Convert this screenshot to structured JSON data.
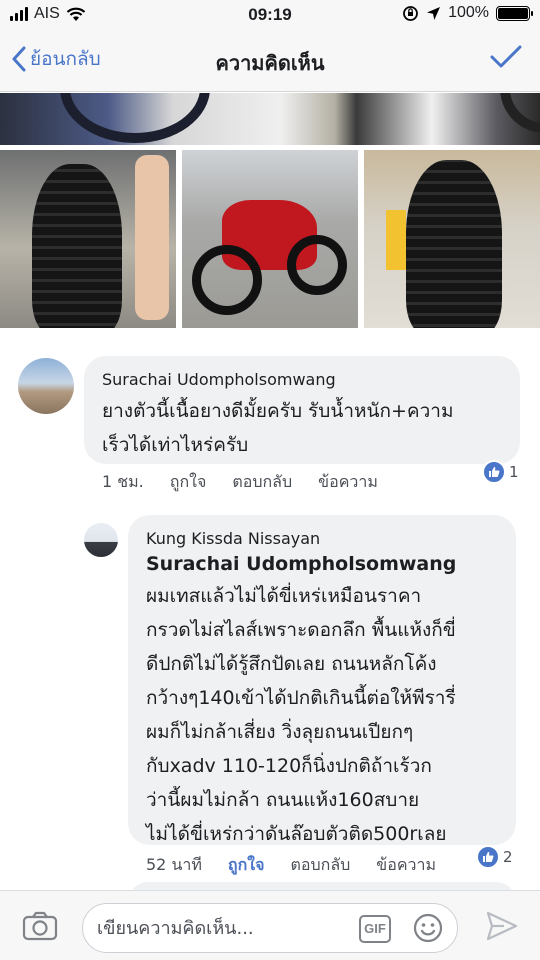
{
  "status_bar": {
    "carrier": "AIS",
    "time": "09:19",
    "battery": "100%"
  },
  "nav": {
    "back_label": "ย้อนกลับ",
    "title": "ความคิดเห็น"
  },
  "comments": [
    {
      "author": "Surachai Udompholsomwang",
      "lines": [
        "ยางตัวนี้เนื้อยางดีมั้ยครับ รับน้ำหนัก+ความ",
        "เร็วได้เท่าไหร่ครับ"
      ],
      "time": "1 ชม.",
      "like": "ถูกใจ",
      "reply": "ตอบกลับ",
      "message": "ข้อความ",
      "like_count": "1"
    },
    {
      "author": "Kung Kissda Nissayan",
      "tag": "Surachai Udompholsomwang",
      "lines": [
        "ผมเทสแล้วไม่ได้ขี่เหร่เหมือนราคา",
        "กรวดไม่สไลส์เพราะดอกลึก พื้นแห้งก็ขี่",
        "ดีปกติไม่ได้รู้สึกปัดเลย  ถนนหลักโค้ง",
        "กว้างๆ140เข้าได้ปกติเกินนี้ต่อให้พีรารี่",
        "ผมก็ไม่กล้าเสี่ยง  วิ่งลุยถนนเปียกๆ",
        "กับxadv   110-120ก็นิ่งปกติถ้าเร้วก",
        "ว่านี้ผมไม่กล้า  ถนนแห้ง160สบาย",
        "ไม่ได้ขี่เหร่กว่าดันล๊อบตัวติด500rเลย"
      ],
      "time": "52 นาที",
      "like": "ถูกใจ",
      "reply": "ตอบกลับ",
      "message": "ข้อความ",
      "like_count": "2"
    }
  ],
  "composer": {
    "placeholder": "เขียนความคิดเห็น...",
    "gif_label": "GIF"
  },
  "colors": {
    "accent": "#4a76c9",
    "bubble": "#f0f1f3",
    "bar": "#f7f7f7"
  }
}
